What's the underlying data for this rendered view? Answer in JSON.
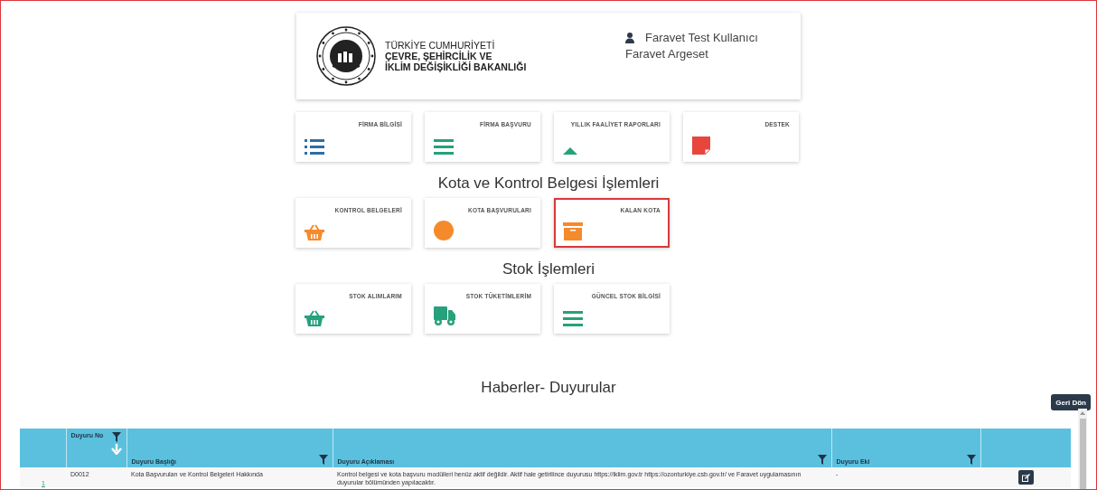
{
  "header": {
    "ministry_lines": [
      "TÜRKİYE CUMHURİYETİ",
      "ÇEVRE, ŞEHİRCİLİK VE",
      "İKLİM DEĞİŞİKLİĞİ BAKANLIĞI"
    ],
    "user_name": "Faravet Test Kullanıcı",
    "organization": "Faravet Argeset"
  },
  "main_tiles": [
    {
      "label": "FİRMA BİLGİSİ",
      "kind": "list",
      "color": "#2e6da4",
      "highlighted": false
    },
    {
      "label": "FİRMA BAŞVURU",
      "kind": "bars",
      "color": "#26a17b",
      "highlighted": false
    },
    {
      "label": "YILLIK FAALİYET RAPORLARI",
      "kind": "triangle",
      "color": "#26a17b",
      "highlighted": false
    },
    {
      "label": "DESTEK",
      "kind": "note",
      "color": "#e8453c",
      "highlighted": false
    }
  ],
  "sections": [
    {
      "title": "Kota ve Kontrol Belgesi İşlemleri",
      "tiles": [
        {
          "label": "KONTROL BELGELERİ",
          "kind": "basket",
          "color": "#f58a2c",
          "highlighted": false
        },
        {
          "label": "KOTA BAŞVURULARI",
          "kind": "circle",
          "color": "#f58a2c",
          "highlighted": false
        },
        {
          "label": "KALAN KOTA",
          "kind": "archive",
          "color": "#f58a2c",
          "highlighted": true
        }
      ]
    },
    {
      "title": "Stok İşlemleri",
      "tiles": [
        {
          "label": "STOK ALIMLARIM",
          "kind": "basket",
          "color": "#26a17b",
          "highlighted": false
        },
        {
          "label": "STOK TÜKETİMLERİM",
          "kind": "truck",
          "color": "#26a17b",
          "highlighted": false
        },
        {
          "label": "GÜNCEL STOK BİLGİSİ",
          "kind": "bars",
          "color": "#26a17b",
          "highlighted": false
        }
      ]
    }
  ],
  "news": {
    "title": "Haberler- Duyurular",
    "back_button": "Geri Dön",
    "table": {
      "columns": [
        {
          "label": "Duyuru No",
          "filter": true,
          "sorted": true
        },
        {
          "label": "Duyuru Başlığı",
          "filter": true,
          "sorted": false
        },
        {
          "label": "Duyuru Açıklaması",
          "filter": true,
          "sorted": false
        },
        {
          "label": "Duyuru Eki",
          "filter": true,
          "sorted": false
        }
      ],
      "rows": [
        {
          "index": "1",
          "cells": [
            "D0012",
            "Kota Başvuruları ve Kontrol Belgeleri Hakkında",
            "Kontrol belgesi ve kota başvuru modülleri henüz aktif değildir. Aktif hale getirilince duyurusu https://iklim.gov.tr  https://ozonturkiye.csb.gov.tr/ ve Faravet uygulamasının duyurular bölümünden yapılacaktır.",
            "-"
          ]
        }
      ]
    }
  }
}
